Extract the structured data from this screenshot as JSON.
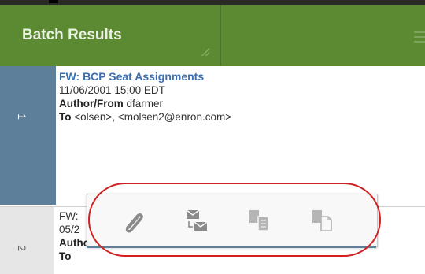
{
  "panel": {
    "title": "Batch Results"
  },
  "rows": [
    {
      "index": "1",
      "subject": "FW: BCP Seat Assignments",
      "date": "11/06/2001 15:00 EDT",
      "author_label": "Author/From",
      "author": "dfarmer",
      "to_label": "To",
      "to": "<olsen>, <molsen2@enron.com>"
    },
    {
      "index": "2",
      "subject": "FW:",
      "date": "05/2",
      "author_label": "Autho",
      "author": "",
      "to_label": "To",
      "to": ""
    }
  ],
  "toolbar": {
    "icons": [
      "paperclip-icon",
      "reply-envelope-icon",
      "copy-documents-icon",
      "copy-documents-outline-icon"
    ]
  },
  "colors": {
    "header": "#5b8a33",
    "selected_index": "#5d7f99",
    "subject_link": "#3b6fae",
    "highlight": "#d02020"
  }
}
